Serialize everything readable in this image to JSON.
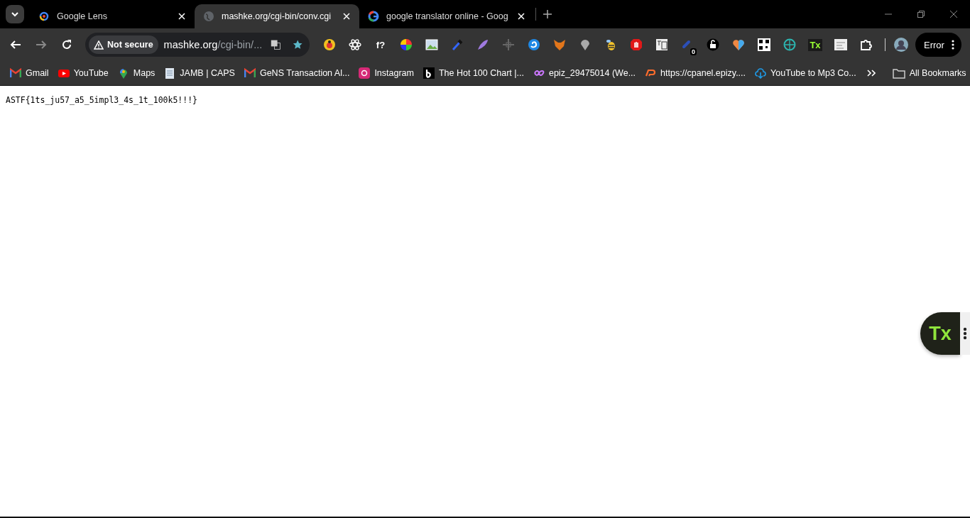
{
  "tabs": [
    {
      "title": "Google Lens",
      "kind": "lens",
      "selected": false
    },
    {
      "title": "mashke.org/cgi-bin/conv.cgi",
      "kind": "globe",
      "selected": true
    },
    {
      "title": "google translator online - Goog",
      "kind": "google",
      "selected": false
    }
  ],
  "address": {
    "security": "Not secure",
    "host": "mashke.org",
    "path": "/cgi-bin/..."
  },
  "extensions": [
    {
      "kind": "ladybug"
    },
    {
      "kind": "atom"
    },
    {
      "kind": "text",
      "label": "f?"
    },
    {
      "kind": "wheel"
    },
    {
      "kind": "image"
    },
    {
      "kind": "dropper"
    },
    {
      "kind": "feather"
    },
    {
      "kind": "move"
    },
    {
      "kind": "swirl"
    },
    {
      "kind": "fox"
    },
    {
      "kind": "pin"
    },
    {
      "kind": "bee"
    },
    {
      "kind": "hand"
    },
    {
      "kind": "translate"
    },
    {
      "kind": "link",
      "badge": "0"
    },
    {
      "kind": "lock"
    },
    {
      "kind": "heart"
    },
    {
      "kind": "qr"
    },
    {
      "kind": "web"
    },
    {
      "kind": "text",
      "label": "Tx"
    },
    {
      "kind": "sketch"
    },
    {
      "kind": "puzzle"
    }
  ],
  "profile_button": "Error",
  "bookmarks": [
    {
      "label": "Gmail",
      "kind": "gmail"
    },
    {
      "label": "YouTube",
      "kind": "youtube"
    },
    {
      "label": "Maps",
      "kind": "maps"
    },
    {
      "label": "JAMB | CAPS",
      "kind": "doc"
    },
    {
      "label": "GeNS Transaction Al...",
      "kind": "gmail"
    },
    {
      "label": "Instagram",
      "kind": "instagram"
    },
    {
      "label": "The Hot 100 Chart |...",
      "kind": "b"
    },
    {
      "label": "epiz_29475014 (We...",
      "kind": "infinity"
    },
    {
      "label": "https://cpanel.epizy....",
      "kind": "cpanel"
    },
    {
      "label": "YouTube to Mp3 Co...",
      "kind": "cloud"
    }
  ],
  "all_bookmarks": "All Bookmarks",
  "page_text": "ASTF{1ts_ju57_a5_5impl3_4s_1t_100k5!!!}",
  "floating_widget": {
    "label": "Tx"
  }
}
